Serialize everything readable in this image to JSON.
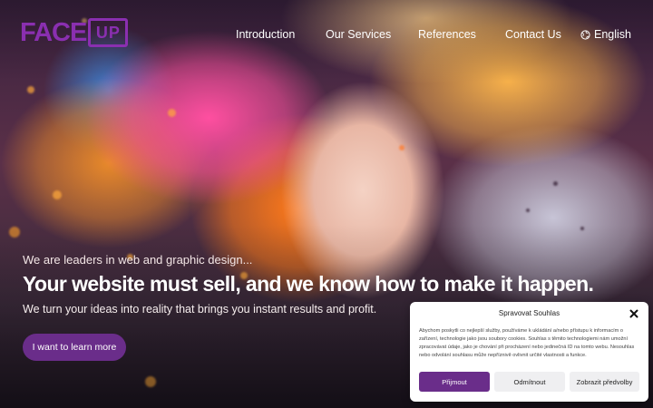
{
  "header": {
    "logo_text": "FACE",
    "logo_mark": "UP",
    "nav": [
      {
        "label": "Introduction"
      },
      {
        "label": "Our Services"
      },
      {
        "label": "References"
      },
      {
        "label": "Contact Us"
      }
    ],
    "language": {
      "label": "English",
      "icon": "globe-icon"
    }
  },
  "hero": {
    "kicker": "We are leaders in web and graphic design...",
    "headline": "Your website must sell, and we know how to make it happen.",
    "subline": "We turn your ideas into reality that brings you instant results and profit.",
    "cta_label": "I want to learn more"
  },
  "consent": {
    "title": "Spravovat Souhlas",
    "body": "Abychom poskytli co nejlepší služby, používáme k ukládání a/nebo přístupu k informacím o zařízení, technologie jako jsou soubory cookies. Souhlas s těmito technologiemi nám umožní zpracovávat údaje, jako je chování při procházení nebo jedinečná ID na tomto webu. Nesouhlas nebo odvolání souhlasu může nepříznivě ovlivnit určité vlastnosti a funkce.",
    "accept_label": "Přijmout",
    "deny_label": "Odmítnout",
    "prefs_label": "Zobrazit předvolby"
  },
  "colors": {
    "brand": "#8a2fb0",
    "button": "#6a2d8a"
  }
}
